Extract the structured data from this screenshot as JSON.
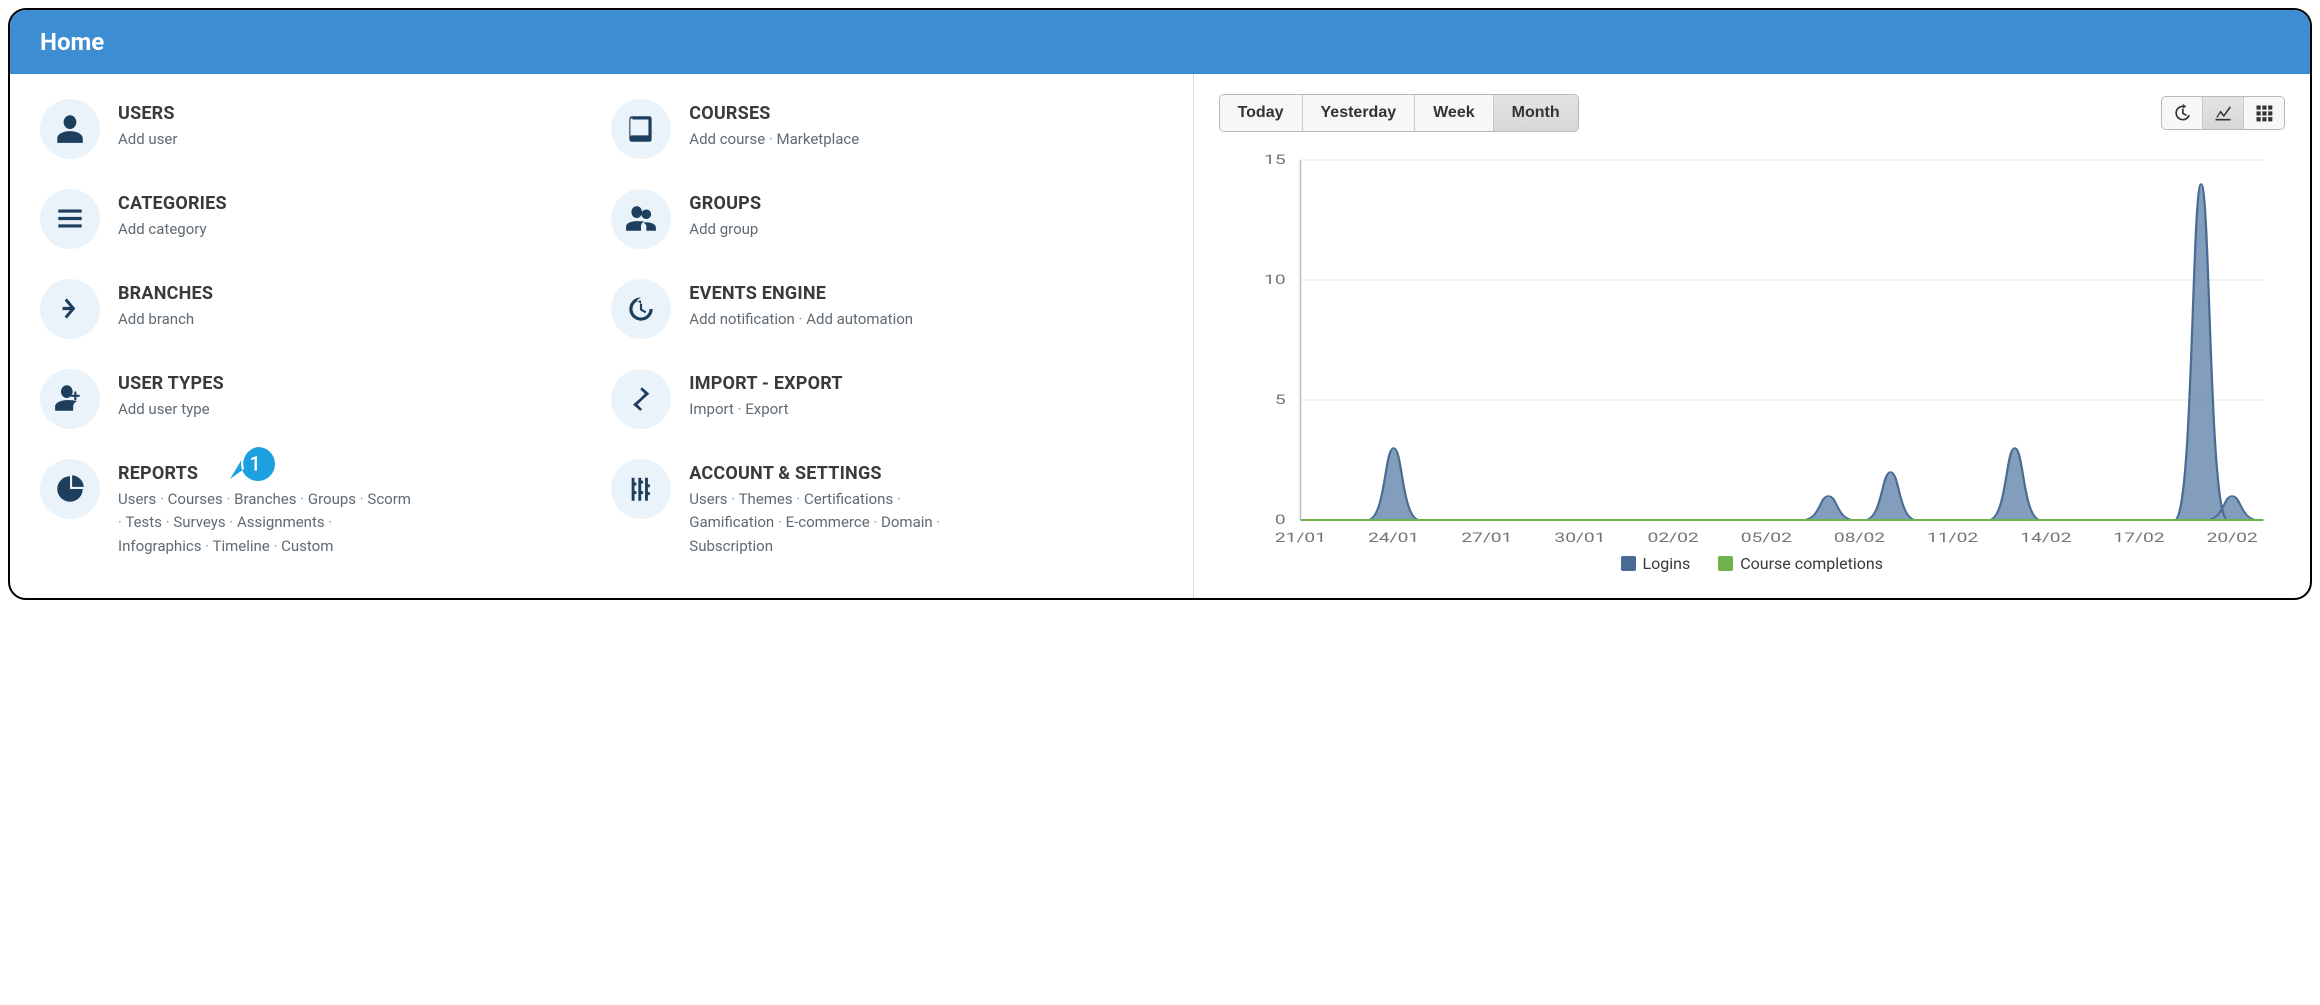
{
  "header": {
    "title": "Home"
  },
  "tiles": [
    {
      "key": "users",
      "title": "USERS",
      "links": [
        "Add user"
      ]
    },
    {
      "key": "courses",
      "title": "COURSES",
      "links": [
        "Add course",
        "Marketplace"
      ]
    },
    {
      "key": "categories",
      "title": "CATEGORIES",
      "links": [
        "Add category"
      ]
    },
    {
      "key": "groups",
      "title": "GROUPS",
      "links": [
        "Add group"
      ]
    },
    {
      "key": "branches",
      "title": "BRANCHES",
      "links": [
        "Add branch"
      ]
    },
    {
      "key": "events",
      "title": "EVENTS ENGINE",
      "links": [
        "Add notification",
        "Add automation"
      ]
    },
    {
      "key": "usertypes",
      "title": "USER TYPES",
      "links": [
        "Add user type"
      ]
    },
    {
      "key": "importexport",
      "title": "IMPORT - EXPORT",
      "links": [
        "Import",
        "Export"
      ]
    },
    {
      "key": "reports",
      "title": "REPORTS",
      "links": [
        "Users",
        "Courses",
        "Branches",
        "Groups",
        "Scorm",
        "Tests",
        "Surveys",
        "Assignments",
        "Infographics",
        "Timeline",
        "Custom"
      ]
    },
    {
      "key": "account",
      "title": "ACCOUNT & SETTINGS",
      "links": [
        "Users",
        "Themes",
        "Certifications",
        "Gamification",
        "E-commerce",
        "Domain",
        "Subscription"
      ]
    }
  ],
  "badge": {
    "on": "reports",
    "value": "1"
  },
  "range_buttons": [
    "Today",
    "Yesterday",
    "Week",
    "Month"
  ],
  "range_active": "Month",
  "view_buttons": [
    "history",
    "chart",
    "grid"
  ],
  "view_active": "chart",
  "chart_data": {
    "type": "area",
    "xlabel": "",
    "ylabel": "",
    "ylim": [
      0,
      15
    ],
    "yticks": [
      0,
      5,
      10,
      15
    ],
    "categories": [
      "21/01",
      "22/01",
      "23/01",
      "24/01",
      "25/01",
      "26/01",
      "27/01",
      "28/01",
      "29/01",
      "30/01",
      "31/01",
      "01/02",
      "02/02",
      "03/02",
      "04/02",
      "05/02",
      "06/02",
      "07/02",
      "08/02",
      "09/02",
      "10/02",
      "11/02",
      "12/02",
      "13/02",
      "14/02",
      "15/02",
      "16/02",
      "17/02",
      "18/02",
      "19/02",
      "20/02",
      "21/02"
    ],
    "tick_every": 3,
    "series": [
      {
        "name": "Logins",
        "color": "#4a6b94",
        "values": [
          0,
          0,
          0,
          3,
          0,
          0,
          0,
          0,
          0,
          0,
          0,
          0,
          0,
          0,
          0,
          0,
          0,
          1,
          0,
          2,
          0,
          0,
          0,
          3,
          0,
          0,
          0,
          0,
          0,
          14,
          1,
          0
        ]
      },
      {
        "name": "Course completions",
        "color": "#6fb24b",
        "values": [
          0,
          0,
          0,
          0,
          0,
          0,
          0,
          0,
          0,
          0,
          0,
          0,
          0,
          0,
          0,
          0,
          0,
          0,
          0,
          0,
          0,
          0,
          0,
          0,
          0,
          0,
          0,
          0,
          0,
          0,
          0,
          0
        ]
      }
    ]
  },
  "legend": [
    "Logins",
    "Course completions"
  ]
}
